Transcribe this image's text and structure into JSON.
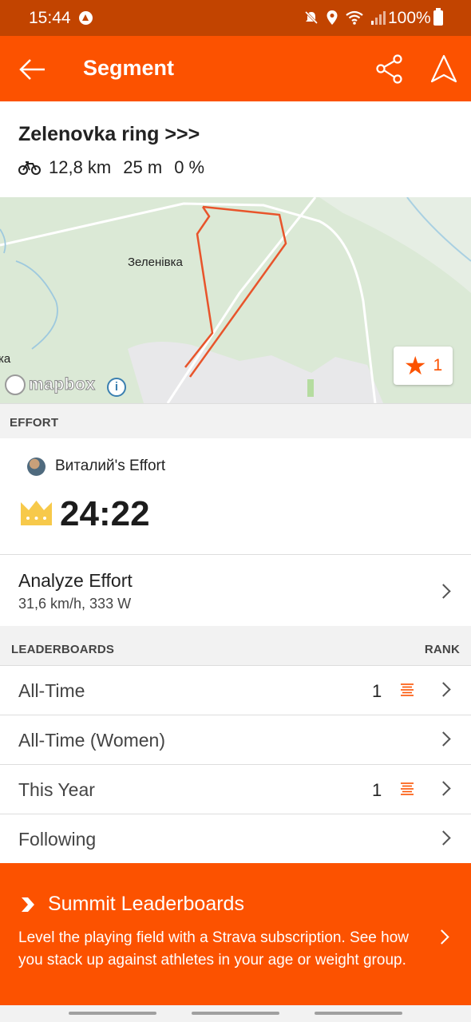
{
  "status_bar": {
    "time": "15:44",
    "battery": "100%"
  },
  "app_bar": {
    "title": "Segment",
    "back_icon": "arrow-left-icon",
    "share_icon": "share-icon",
    "navigate_icon": "navigation-arrow-icon"
  },
  "segment": {
    "name": "Zelenovka ring >>>",
    "activity_icon": "bike-icon",
    "distance": "12,8 km",
    "elevation": "25 m",
    "grade": "0 %"
  },
  "map": {
    "place_label": "Зеленівка",
    "edge_label": "ка",
    "attribution": "mapbox",
    "star_count": "1",
    "route_color": "#e8542b"
  },
  "effort": {
    "section_label": "EFFORT",
    "athlete": "Виталий's Effort",
    "time": "24:22",
    "crown_icon": "crown-icon"
  },
  "analyze": {
    "title": "Analyze Effort",
    "subtitle": "31,6 km/h, 333 W"
  },
  "leaderboards": {
    "section_label": "LEADERBOARDS",
    "rank_label": "RANK",
    "rows": [
      {
        "label": "All-Time",
        "rank": "1"
      },
      {
        "label": "All-Time (Women)",
        "rank": ""
      },
      {
        "label": "This Year",
        "rank": "1"
      },
      {
        "label": "Following",
        "rank": ""
      }
    ]
  },
  "summit": {
    "title": "Summit Leaderboards",
    "body": "Level the playing field with a Strava subscription. See how you stack up against athletes in your age or weight group."
  },
  "colors": {
    "brand": "#fc5200",
    "status_bar": "#c24400"
  }
}
